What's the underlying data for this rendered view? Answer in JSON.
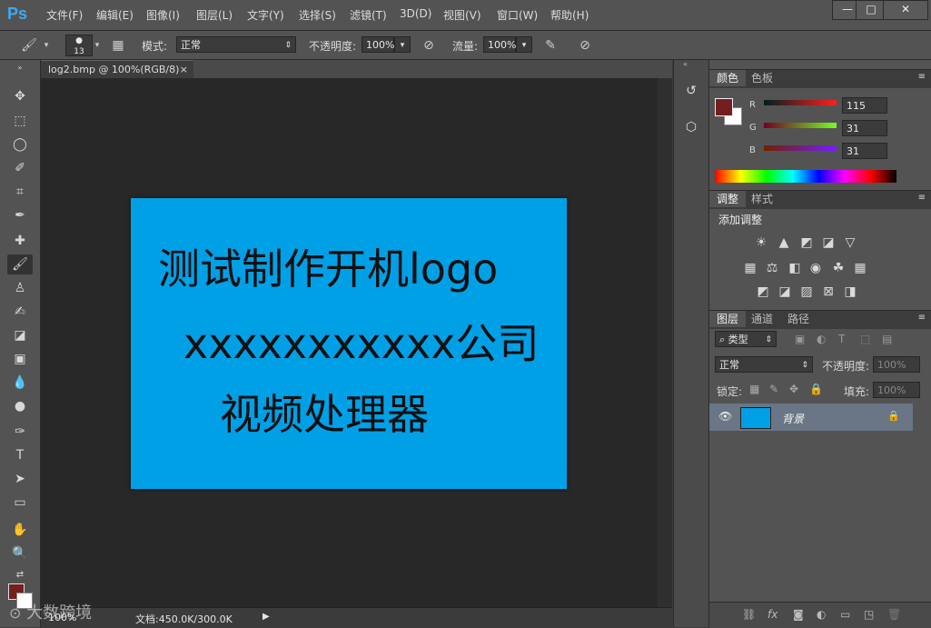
{
  "app": {
    "logo": "Ps"
  },
  "menu": [
    "文件(F)",
    "编辑(E)",
    "图像(I)",
    "图层(L)",
    "文字(Y)",
    "选择(S)",
    "滤镜(T)",
    "3D(D)",
    "视图(V)",
    "窗口(W)",
    "帮助(H)"
  ],
  "window_controls": {
    "minimize": "—",
    "maximize": "□",
    "close": "✕"
  },
  "options": {
    "brush_size": "13",
    "mode_label": "模式:",
    "mode_value": "正常",
    "opacity_label": "不透明度:",
    "opacity_value": "100%",
    "flow_label": "流量:",
    "flow_value": "100%"
  },
  "document": {
    "tab_title": "log2.bmp @ 100%(RGB/8)",
    "tab_close": "×",
    "lines": [
      "测试制作开机logo",
      "xxxxxxxxxxx公司",
      "视频处理器"
    ],
    "background_color": "#00a0e6"
  },
  "status": {
    "zoom": "100%",
    "doc_info": "文档:450.0K/300.0K",
    "watermark": "大数跨境"
  },
  "color_panel": {
    "tabs": [
      "颜色",
      "色板"
    ],
    "foreground": "#731f1f",
    "r_label": "R",
    "r_value": "115",
    "g_label": "G",
    "g_value": "31",
    "b_label": "B",
    "b_value": "31"
  },
  "adjust_panel": {
    "tabs": [
      "调整",
      "样式"
    ],
    "title": "添加调整"
  },
  "layers_panel": {
    "tabs": [
      "图层",
      "通道",
      "路径"
    ],
    "filter_label": "类型",
    "blend_mode": "正常",
    "opacity_label": "不透明度:",
    "opacity_value": "100%",
    "lock_label": "锁定:",
    "fill_label": "填充:",
    "fill_value": "100%",
    "layer_name": "背景"
  }
}
